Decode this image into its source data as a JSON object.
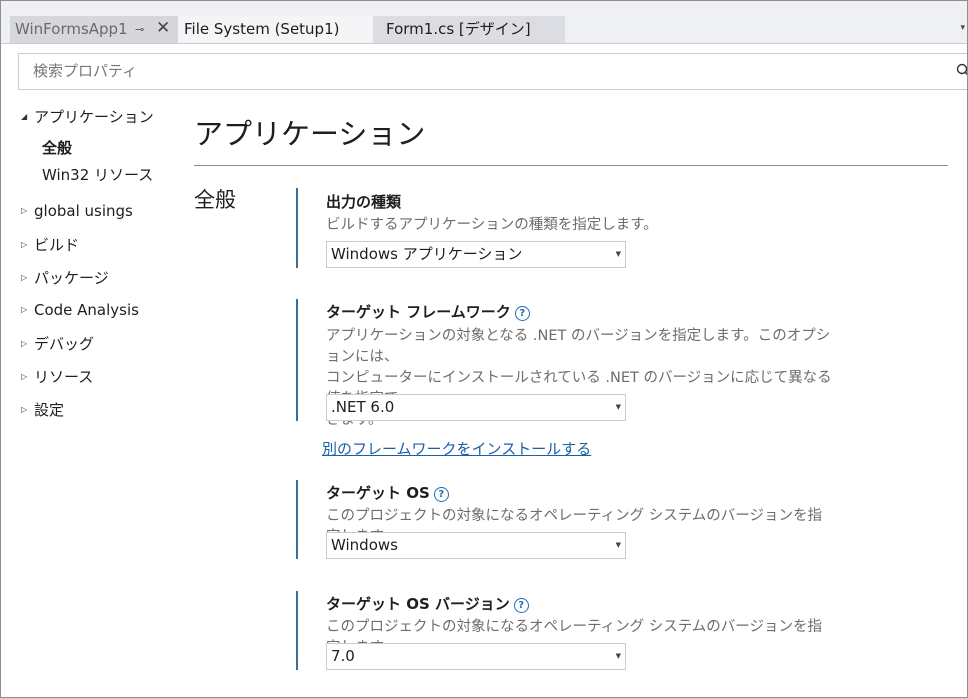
{
  "tabs": [
    {
      "label": "WinFormsApp1",
      "active": true,
      "pin": "⊸",
      "close": "✕"
    },
    {
      "label": "File System (Setup1)",
      "active": false
    },
    {
      "label": "Form1.cs [デザイン]",
      "active": false
    }
  ],
  "tab_overflow_icon": "▾",
  "search": {
    "placeholder": "検索プロパティ",
    "value": ""
  },
  "nav": {
    "arrow_expanded": "◢",
    "arrow_collapsed": "▷",
    "items": [
      {
        "label": "アプリケーション",
        "expanded": true
      },
      {
        "label": "global usings"
      },
      {
        "label": "ビルド"
      },
      {
        "label": "パッケージ"
      },
      {
        "label": "Code Analysis"
      },
      {
        "label": "デバッグ"
      },
      {
        "label": "リソース"
      },
      {
        "label": "設定"
      }
    ],
    "sub_items": [
      {
        "label": "全般",
        "selected": true
      },
      {
        "label": "Win32 リソース",
        "selected": false
      }
    ]
  },
  "page": {
    "title": "アプリケーション",
    "section": "全般"
  },
  "settings": {
    "output_type": {
      "label": "出力の種類",
      "description": "ビルドするアプリケーションの種類を指定します。",
      "value": "Windows アプリケーション"
    },
    "target_framework": {
      "label": "ターゲット フレームワーク",
      "description_line1": "アプリケーションの対象となる .NET のバージョンを指定します。このオプションには、",
      "description_line2": "コンピューターにインストールされている .NET のバージョンに応じて異なる値を指定で",
      "description_line3": "きます。",
      "value": ".NET 6.0"
    },
    "install_link": "別のフレームワークをインストールする",
    "target_os": {
      "label": "ターゲット OS",
      "description": "このプロジェクトの対象になるオペレーティング システムのバージョンを指定します。",
      "value": "Windows"
    },
    "target_os_version": {
      "label": "ターゲット OS バージョン",
      "description": "このプロジェクトの対象になるオペレーティング システムのバージョンを指定します。",
      "value": "7.0"
    }
  },
  "help_glyph": "?",
  "caret_glyph": "▼",
  "colors": {
    "accent_bar": "#3d7099",
    "link": "#1a5fa8",
    "help_icon": "#1e6fb8"
  }
}
